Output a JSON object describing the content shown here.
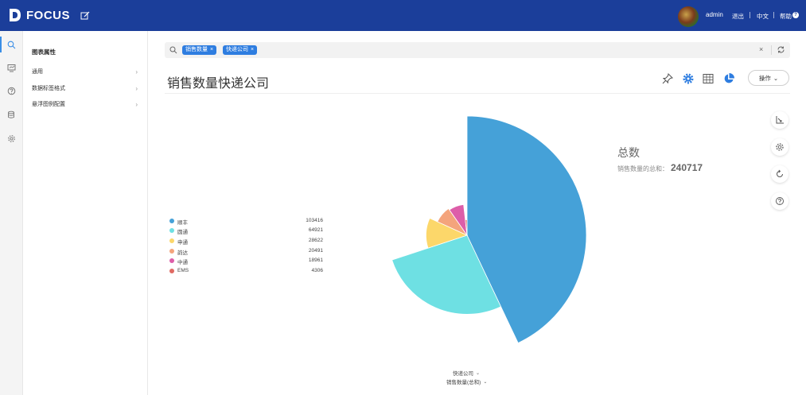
{
  "app": {
    "brand": "FOCUS"
  },
  "topbar": {
    "user": "admin",
    "logout": "退出",
    "language": "中文",
    "help": "帮助",
    "help_glyph": "?"
  },
  "rail": {
    "items": [
      {
        "icon": "search-icon",
        "active": true
      },
      {
        "icon": "dashboard-icon",
        "active": false
      },
      {
        "icon": "question-icon",
        "active": false
      },
      {
        "icon": "database-icon",
        "active": false
      },
      {
        "icon": "gear-icon",
        "active": false
      }
    ]
  },
  "panel": {
    "title": "图表属性",
    "items": [
      {
        "label": "通用",
        "chevron": "›"
      },
      {
        "label": "数据标签格式",
        "chevron": "›"
      },
      {
        "label": "悬浮图例配置",
        "chevron": "›"
      }
    ]
  },
  "search": {
    "tags": [
      {
        "label": "销售数量",
        "remove": "×"
      },
      {
        "label": "快递公司",
        "remove": "×"
      }
    ],
    "clear": "×"
  },
  "page": {
    "title": "销售数量快递公司",
    "operation_button": "操作",
    "operation_chevron": "⌄"
  },
  "summary": {
    "title": "总数",
    "label": "销售数量的总和：",
    "value": "240717"
  },
  "axis": {
    "x_label": "快递公司",
    "y_label": "销售数量(总和)",
    "chevron": "⌄"
  },
  "colors": {
    "topbar": "#1b3e9a",
    "accent": "#2e7de0"
  },
  "chart_data": {
    "type": "pie",
    "variant": "rose",
    "categories": [
      "顺丰",
      "圆通",
      "申通",
      "韵达",
      "中通",
      "EMS"
    ],
    "values": [
      103416,
      64921,
      28622,
      20491,
      18961,
      4306
    ],
    "colors": [
      "#45a1d8",
      "#6ee0e3",
      "#fcd76a",
      "#f4a47c",
      "#dd5ea9",
      "#e06a63"
    ],
    "legend_position": "left"
  }
}
